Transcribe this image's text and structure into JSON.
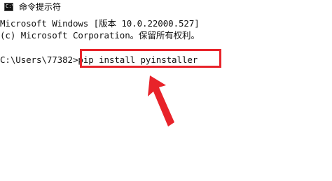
{
  "window": {
    "title": "命令提示符",
    "icon": "cmd-icon",
    "icon_glyph": "C:\\"
  },
  "console": {
    "line1": "Microsoft Windows [版本 10.0.22000.527]",
    "line2": "(c) Microsoft Corporation。保留所有权利。",
    "prompt": "C:\\Users\\77382>",
    "command": "pip install pyinstaller"
  },
  "annotation": {
    "color": "#e8232a",
    "arrow_icon": "red-arrow-icon"
  }
}
